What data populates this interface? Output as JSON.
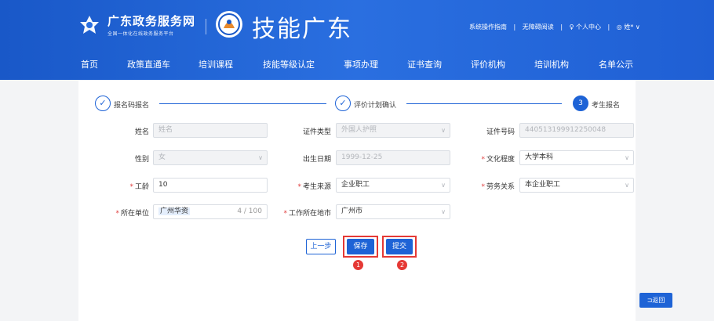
{
  "header": {
    "brand_title": "广东政务服务网",
    "brand_subtitle": "全国一体化在线政务服务平台",
    "site_title": "技能广东",
    "links": [
      "系统操作指南",
      "|",
      "无障碍阅读",
      "|",
      "♀ 个人中心",
      "|",
      "◎ 姓* ∨"
    ]
  },
  "nav": [
    "首页",
    "政策直通车",
    "培训课程",
    "技能等级认定",
    "事项办理",
    "证书查询",
    "评价机构",
    "培训机构",
    "名单公示"
  ],
  "steps": [
    {
      "label": "报名码报名",
      "mark": "✓"
    },
    {
      "label": "评价计划确认",
      "mark": "✓"
    },
    {
      "label": "考生报名",
      "mark": "3"
    }
  ],
  "form": {
    "name": {
      "label": "姓名",
      "placeholder": "姓名"
    },
    "id_type": {
      "label": "证件类型",
      "value": "外国人护照"
    },
    "id_number": {
      "label": "证件号码",
      "value": "440513199912250048"
    },
    "gender": {
      "label": "性别",
      "value": "女"
    },
    "birth": {
      "label": "出生日期",
      "value": "1999-12-25"
    },
    "education": {
      "label": "文化程度",
      "value": "大学本科"
    },
    "seniority": {
      "label": "工龄",
      "value": "10"
    },
    "source": {
      "label": "考生来源",
      "value": "企业职工"
    },
    "labor": {
      "label": "劳务关系",
      "value": "本企业职工"
    },
    "employer": {
      "label": "所在单位",
      "value": "广州华资",
      "counter": "4 / 100"
    },
    "work_city": {
      "label": "工作所在地市",
      "value": "广州市"
    }
  },
  "buttons": {
    "prev": "上一步",
    "save": "保存",
    "submit": "提交",
    "back": "⊐返回"
  },
  "badges": [
    "1",
    "2"
  ],
  "colors": {
    "primary": "#1e63d6",
    "highlight": "#e53935"
  }
}
